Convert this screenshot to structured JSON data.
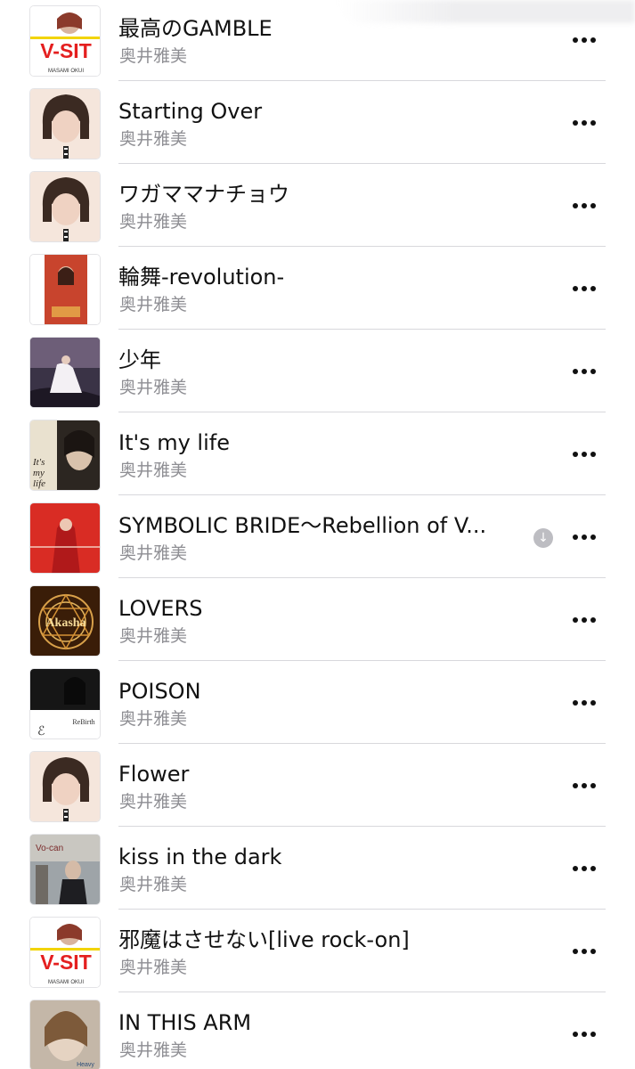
{
  "songs": [
    {
      "title": "最高のGAMBLE",
      "artist": "奥井雅美",
      "art": "vsit"
    },
    {
      "title": "Starting Over",
      "artist": "奥井雅美",
      "art": "bob"
    },
    {
      "title": "ワガママナチョウ",
      "artist": "奥井雅美",
      "art": "bob"
    },
    {
      "title": "輪舞-revolution-",
      "artist": "奥井雅美",
      "art": "revolution"
    },
    {
      "title": "少年",
      "artist": "奥井雅美",
      "art": "shonen"
    },
    {
      "title": "It's my life",
      "artist": "奥井雅美",
      "art": "mylife"
    },
    {
      "title": "SYMBOLIC BRIDE～Rebellion of V...",
      "artist": "奥井雅美",
      "art": "symbolic",
      "downloadable": true
    },
    {
      "title": "LOVERS",
      "artist": "奥井雅美",
      "art": "akasha"
    },
    {
      "title": "POISON",
      "artist": "奥井雅美",
      "art": "rebirth"
    },
    {
      "title": "Flower",
      "artist": "奥井雅美",
      "art": "bob"
    },
    {
      "title": "kiss in the dark",
      "artist": "奥井雅美",
      "art": "kiss"
    },
    {
      "title": "邪魔はさせない[live rock-on]",
      "artist": "奥井雅美",
      "art": "vsit"
    },
    {
      "title": "IN THIS ARM",
      "artist": "奥井雅美",
      "art": "inthisarm"
    }
  ],
  "art_text": {
    "vsit": "V-SIT",
    "akasha": "Akasha",
    "rebirth": "ReBirth",
    "mylife": "It's my life"
  },
  "icons": {
    "more": "more-ellipsis-icon",
    "download": "download-arrow-icon"
  }
}
